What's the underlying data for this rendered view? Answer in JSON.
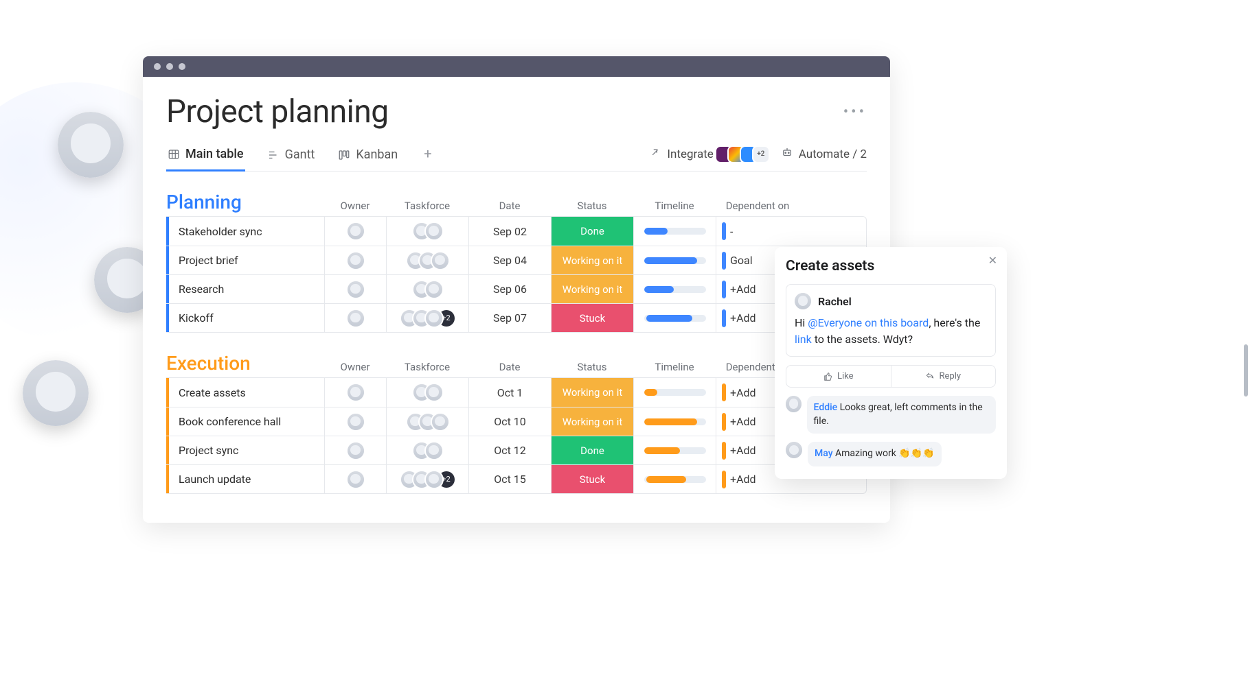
{
  "board": {
    "title": "Project planning",
    "views": {
      "main": "Main table",
      "gantt": "Gantt",
      "kanban": "Kanban"
    },
    "integrate_label": "Integrate",
    "integrate_overflow": "+2",
    "automate_label": "Automate / 2",
    "columns": {
      "owner": "Owner",
      "taskforce": "Taskforce",
      "date": "Date",
      "status": "Status",
      "timeline": "Timeline",
      "dependent": "Dependent on"
    }
  },
  "groups": [
    {
      "name": "Planning",
      "color": "#2f7fff",
      "rows": [
        {
          "task": "Stakeholder sync",
          "date": "Sep 02",
          "status": "Done",
          "status_key": "done",
          "tl_start": 0,
          "tl_width": 38,
          "dep": "-",
          "tf_count": 2,
          "tf_plus": ""
        },
        {
          "task": "Project brief",
          "date": "Sep 04",
          "status": "Working on it",
          "status_key": "work",
          "tl_start": 0,
          "tl_width": 86,
          "dep": "Goal",
          "tf_count": 3,
          "tf_plus": ""
        },
        {
          "task": "Research",
          "date": "Sep 06",
          "status": "Working on it",
          "status_key": "work",
          "tl_start": 0,
          "tl_width": 48,
          "dep": "+Add",
          "tf_count": 2,
          "tf_plus": ""
        },
        {
          "task": "Kickoff",
          "date": "Sep 07",
          "status": "Stuck",
          "status_key": "stuck",
          "tl_start": 4,
          "tl_width": 74,
          "dep": "+Add",
          "tf_count": 3,
          "tf_plus": "+2"
        }
      ]
    },
    {
      "name": "Execution",
      "color": "#ff9b1a",
      "rows": [
        {
          "task": "Create assets",
          "date": "Oct 1",
          "status": "Working on it",
          "status_key": "work",
          "tl_start": 0,
          "tl_width": 22,
          "dep": "+Add",
          "tf_count": 2,
          "tf_plus": ""
        },
        {
          "task": "Book conference hall",
          "date": "Oct 10",
          "status": "Working on it",
          "status_key": "work",
          "tl_start": 0,
          "tl_width": 86,
          "dep": "+Add",
          "tf_count": 3,
          "tf_plus": ""
        },
        {
          "task": "Project sync",
          "date": "Oct 12",
          "status": "Done",
          "status_key": "done",
          "tl_start": 0,
          "tl_width": 58,
          "dep": "+Add",
          "tf_count": 2,
          "tf_plus": ""
        },
        {
          "task": "Launch update",
          "date": "Oct 15",
          "status": "Stuck",
          "status_key": "stuck",
          "tl_start": 4,
          "tl_width": 64,
          "dep": "+Add",
          "tf_count": 3,
          "tf_plus": "+2"
        }
      ]
    }
  ],
  "panel": {
    "title": "Create assets",
    "post_author": "Rachel",
    "post_pre": "Hi ",
    "post_mention": "@Everyone on this board",
    "post_mid": ", here's the ",
    "post_link": "link",
    "post_end": " to the assets. Wdyt?",
    "like": "Like",
    "reply": "Reply",
    "r1_who": "Eddie",
    "r1_text": " Looks great, left comments in the file.",
    "r2_who": "May",
    "r2_text": " Amazing work 👏👏👏"
  }
}
